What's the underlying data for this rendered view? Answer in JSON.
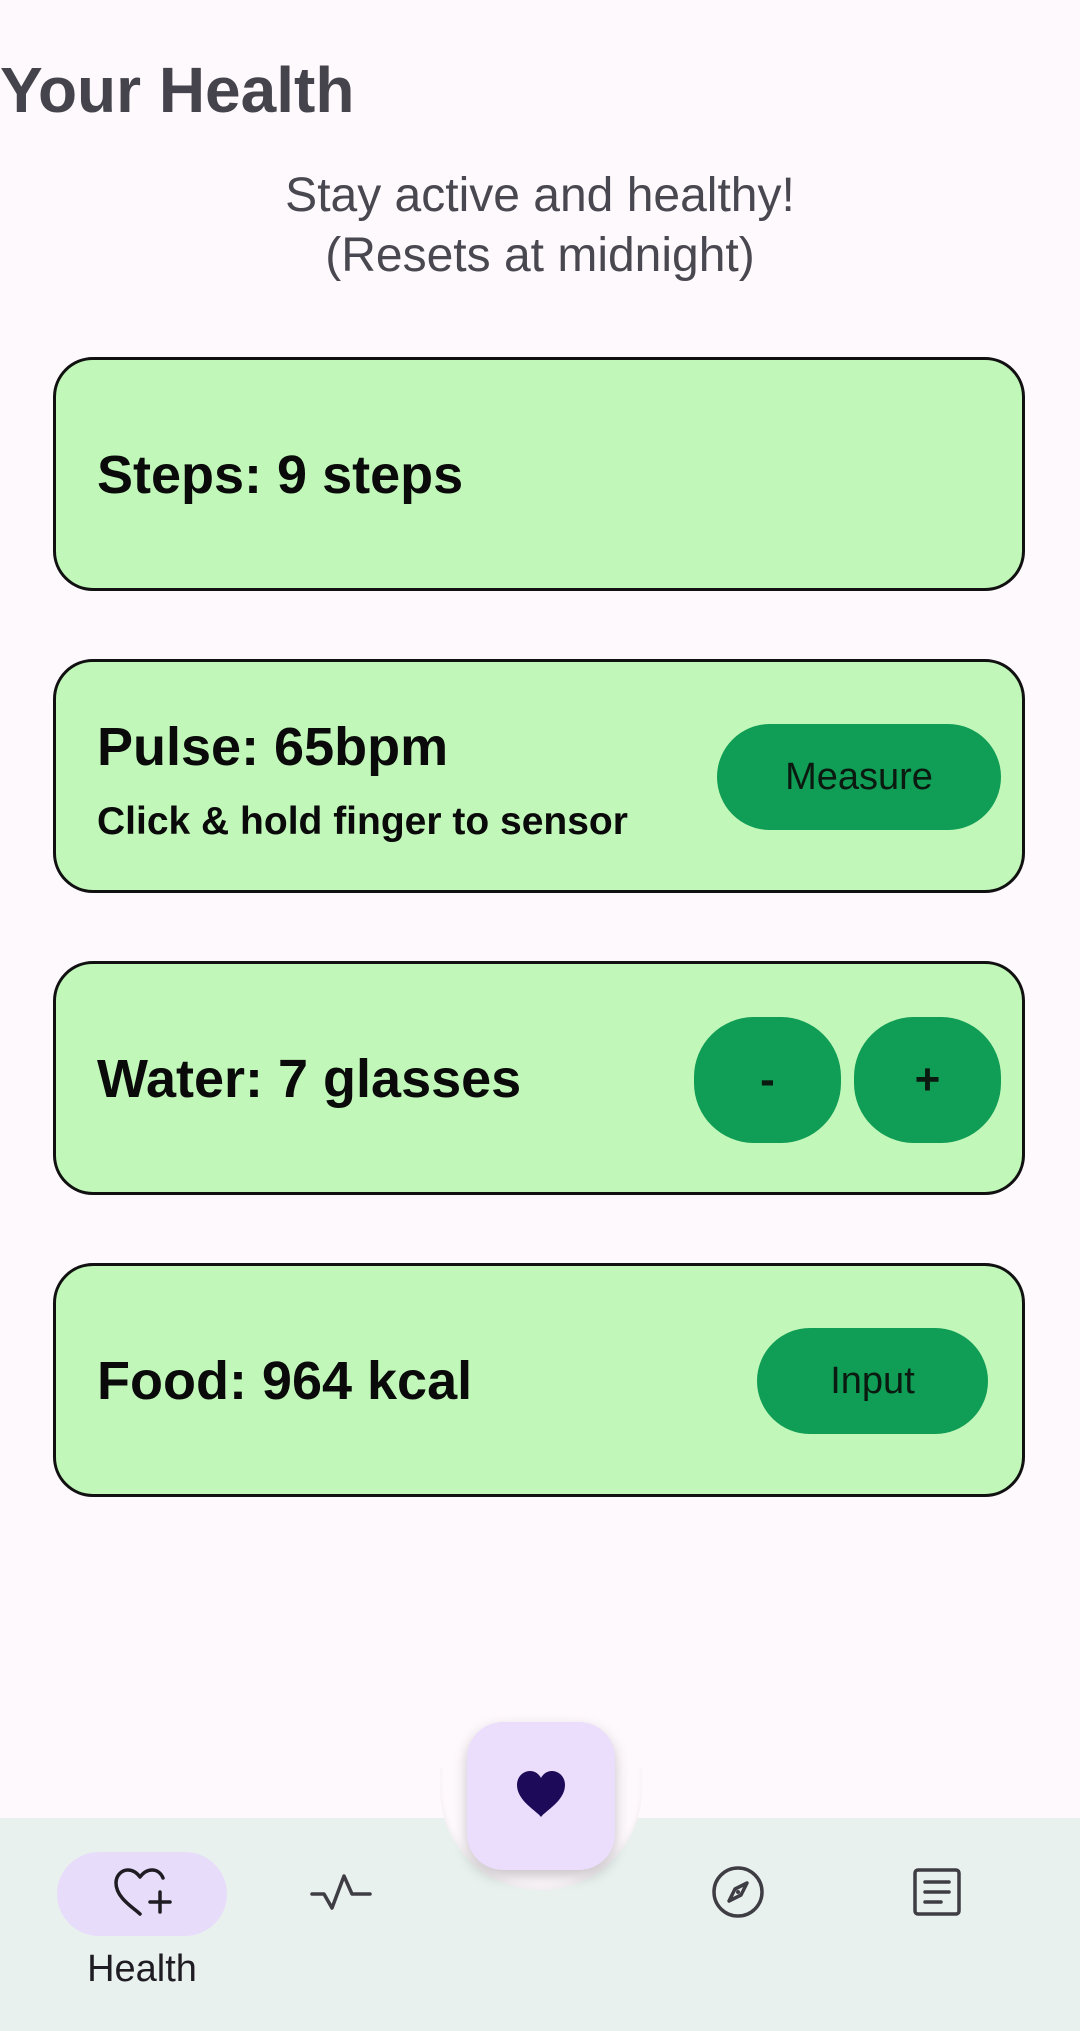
{
  "header": {
    "title": "Your Health",
    "subtitle_line1": "Stay active and healthy!",
    "subtitle_line2": "(Resets at midnight)"
  },
  "cards": {
    "steps": {
      "label": "Steps: 9 steps"
    },
    "pulse": {
      "label": "Pulse: 65bpm",
      "hint": "Click & hold finger to sensor",
      "button": "Measure"
    },
    "water": {
      "label": "Water: 7 glasses",
      "minus": "-",
      "plus": "+"
    },
    "food": {
      "label": "Food: 964 kcal",
      "button": "Input"
    }
  },
  "nav": {
    "items": [
      {
        "icon": "heart-plus-icon",
        "label": "Health",
        "active": true
      },
      {
        "icon": "pulse-icon"
      },
      {
        "icon": "compass-icon"
      },
      {
        "icon": "document-icon"
      }
    ],
    "fab_icon": "heart-icon"
  },
  "colors": {
    "background": "#fef9fd",
    "card": "#c1f7b9",
    "button": "#109d55",
    "navbar": "#e9f1ee",
    "fab": "#ebdefd",
    "active_pill": "#e7ddfb",
    "fab_icon": "#1d0a58"
  }
}
